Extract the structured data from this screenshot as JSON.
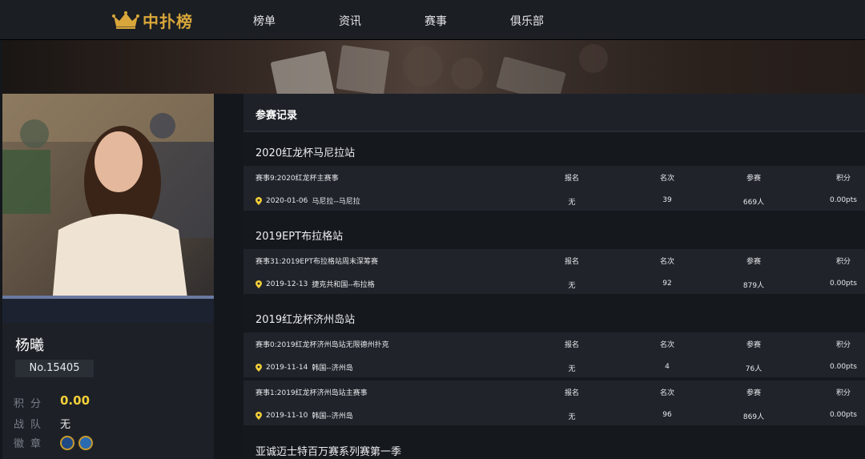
{
  "brand": {
    "logo_text": "中扑榜",
    "logo_color": "#d8a63a"
  },
  "nav": {
    "items": [
      {
        "label": "榜单"
      },
      {
        "label": "资讯"
      },
      {
        "label": "赛事"
      },
      {
        "label": "俱乐部"
      }
    ]
  },
  "profile": {
    "name": "杨曦",
    "number": "No.15405",
    "points_label": "积分",
    "points_value": "0.00",
    "team_label": "战队",
    "team_value": "无",
    "badges_label": "徽章"
  },
  "records": {
    "title": "参赛记录",
    "headers": {
      "signup": "报名",
      "rank": "名次",
      "entries": "参赛",
      "points": "积分"
    },
    "events": [
      {
        "title": "2020红龙杯马尼拉站",
        "matches": [
          {
            "name": "赛事9:2020红龙杯主赛事",
            "date": "2020-01-06",
            "location": "马尼拉--马尼拉",
            "signup": "无",
            "rank": "39",
            "entries": "669人",
            "points": "0.00pts"
          }
        ]
      },
      {
        "title": "2019EPT布拉格站",
        "matches": [
          {
            "name": "赛事31:2019EPT布拉格站周末深筹赛",
            "date": "2019-12-13",
            "location": "捷克共和国--布拉格",
            "signup": "无",
            "rank": "92",
            "entries": "879人",
            "points": "0.00pts"
          }
        ]
      },
      {
        "title": "2019红龙杯济州岛站",
        "matches": [
          {
            "name": "赛事0:2019红龙杯济州岛站无限德州扑克",
            "date": "2019-11-14",
            "location": "韩国--济州岛",
            "signup": "无",
            "rank": "4",
            "entries": "76人",
            "points": "0.00pts"
          },
          {
            "name": "赛事1:2019红龙杯济州岛站主赛事",
            "date": "2019-11-10",
            "location": "韩国--济州岛",
            "signup": "无",
            "rank": "96",
            "entries": "869人",
            "points": "0.00pts"
          }
        ]
      },
      {
        "title": "亚诚迈士特百万赛系列赛第一季",
        "matches": []
      }
    ]
  }
}
